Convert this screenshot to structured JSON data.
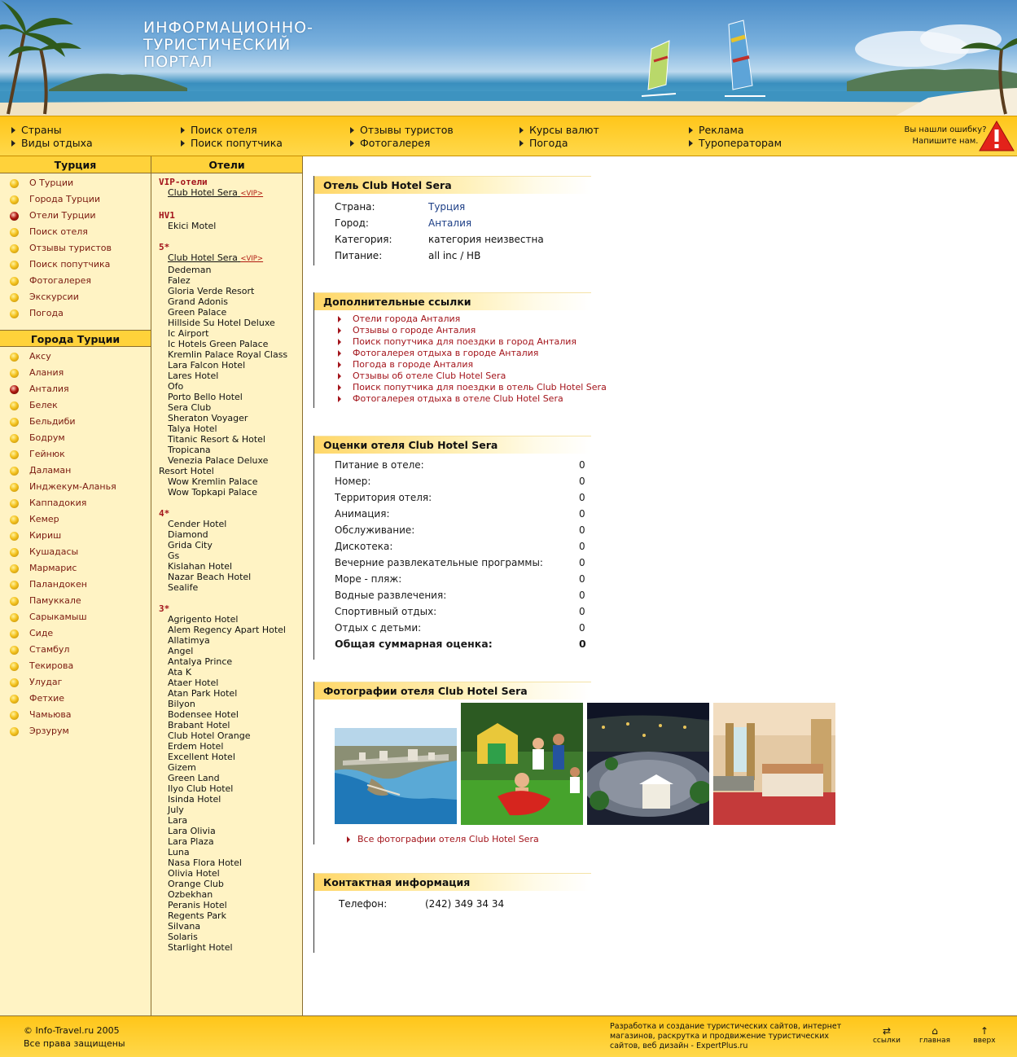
{
  "header": {
    "title_lines": [
      "ИНФОРМАЦИОННО-",
      "ТУРИСТИЧЕСКИЙ",
      "ПОРТАЛ"
    ]
  },
  "topnav": {
    "columns": [
      [
        "Страны",
        "Виды отдыха"
      ],
      [
        "Поиск отеля",
        "Поиск попутчика"
      ],
      [
        "Отзывы туристов",
        "Фотогалерея"
      ],
      [
        "Курсы валют",
        "Погода"
      ],
      [
        "Реклама",
        "Туроператорам"
      ]
    ],
    "error_line1": "Вы нашли ошибку?",
    "error_line2": "Напишите нам."
  },
  "left_menu": {
    "heading": "Турция",
    "items": [
      "О Турции",
      "Города Турции",
      "Отели Турции",
      "Поиск отеля",
      "Отзывы туристов",
      "Поиск попутчика",
      "Фотогалерея",
      "Экскурсии",
      "Погода"
    ],
    "active_index": 2
  },
  "cities_menu": {
    "heading": "Города Турции",
    "items": [
      "Аксу",
      "Алания",
      "Анталия",
      "Белек",
      "Бельдиби",
      "Бодрум",
      "Гейнюк",
      "Даламан",
      "Инджекум-Аланья",
      "Каппадокия",
      "Кемер",
      "Кириш",
      "Кушадасы",
      "Мармарис",
      "Паландокен",
      "Памуккале",
      "Сарыкамыш",
      "Сиде",
      "Стамбул",
      "Текирова",
      "Улудаг",
      "Фетхие",
      "Чамьюва",
      "Эрзурум"
    ],
    "active_index": 2
  },
  "hotels": {
    "heading": "Отели",
    "vip_mark": "<VIP>",
    "groups": [
      {
        "title": "VIP-отели",
        "items": [
          {
            "name": "Club Hotel Sera",
            "vip": true
          }
        ]
      },
      {
        "title": "HV1",
        "items": [
          {
            "name": "Ekici Motel"
          }
        ]
      },
      {
        "title": "5*",
        "items": [
          {
            "name": "Club Hotel Sera",
            "vip": true
          },
          {
            "name": "Dedeman"
          },
          {
            "name": "Falez"
          },
          {
            "name": "Gloria Verde Resort"
          },
          {
            "name": "Grand Adonis"
          },
          {
            "name": "Green Palace"
          },
          {
            "name": "Hillside Su Hotel Deluxe"
          },
          {
            "name": "Ic Airport"
          },
          {
            "name": "Ic Hotels Green Palace"
          },
          {
            "name": "Kremlin Palace Royal Class"
          },
          {
            "name": "Lara Falcon Hotel"
          },
          {
            "name": "Lares Hotel"
          },
          {
            "name": "Ofo"
          },
          {
            "name": "Porto Bello Hotel"
          },
          {
            "name": "Sera Club"
          },
          {
            "name": "Sheraton Voyager"
          },
          {
            "name": "Talya Hotel"
          },
          {
            "name": "Titanic Resort & Hotel"
          },
          {
            "name": "Tropicana"
          },
          {
            "name": "Venezia Palace Deluxe"
          }
        ],
        "sub": "Resort Hotel",
        "sub_items": [
          {
            "name": "Wow Kremlin Palace"
          },
          {
            "name": "Wow Topkapi Palace"
          }
        ]
      },
      {
        "title": "4*",
        "items": [
          {
            "name": "Cender Hotel"
          },
          {
            "name": "Diamond"
          },
          {
            "name": "Grida City"
          },
          {
            "name": "Gs"
          },
          {
            "name": "Kislahan Hotel"
          },
          {
            "name": "Nazar Beach Hotel"
          },
          {
            "name": "Sealife"
          }
        ]
      },
      {
        "title": "3*",
        "items": [
          {
            "name": "Agrigento Hotel"
          },
          {
            "name": "Alem Regency Apart Hotel"
          },
          {
            "name": "Allatimya"
          },
          {
            "name": "Angel"
          },
          {
            "name": "Antalya Prince"
          },
          {
            "name": "Ata K"
          },
          {
            "name": "Ataer Hotel"
          },
          {
            "name": "Atan Park Hotel"
          },
          {
            "name": "Bilyon"
          },
          {
            "name": "Bodensee Hotel"
          },
          {
            "name": "Brabant Hotel"
          },
          {
            "name": "Club Hotel Orange"
          },
          {
            "name": "Erdem Hotel"
          },
          {
            "name": "Excellent Hotel"
          },
          {
            "name": "Gizem"
          },
          {
            "name": "Green Land"
          },
          {
            "name": "Ilyo Club Hotel"
          },
          {
            "name": "Isinda Hotel"
          },
          {
            "name": "July"
          },
          {
            "name": "Lara"
          },
          {
            "name": "Lara Olivia"
          },
          {
            "name": "Lara Plaza"
          },
          {
            "name": "Luna"
          },
          {
            "name": "Nasa Flora Hotel"
          },
          {
            "name": "Olivia Hotel"
          },
          {
            "name": "Orange Club"
          },
          {
            "name": "Ozbekhan"
          },
          {
            "name": "Peranis Hotel"
          },
          {
            "name": "Regents Park"
          },
          {
            "name": "Silvana"
          },
          {
            "name": "Solaris"
          },
          {
            "name": "Starlight Hotel"
          }
        ]
      }
    ]
  },
  "hotel_info": {
    "heading": "Отель Club Hotel Sera",
    "rows": [
      {
        "k": "Страна:",
        "v": "Турция",
        "link": true
      },
      {
        "k": "Город:",
        "v": "Анталия",
        "link": true
      },
      {
        "k": "Категория:",
        "v": "категория неизвестна",
        "link": false
      },
      {
        "k": "Питание:",
        "v": "all inc / HB",
        "link": false
      }
    ]
  },
  "extra_links": {
    "heading": "Дополнительные ссылки",
    "items": [
      "Отели города Анталия",
      "Отзывы о городе Анталия",
      "Поиск попутчика для поездки в город Анталия",
      "Фотогалерея отдыха в городе Анталия",
      "Погода в городе Анталия",
      "Отзывы об отеле Club Hotel Sera",
      "Поиск попутчика для поездки в отель Club Hotel Sera",
      "Фотогалерея отдыха в отеле Club Hotel Sera"
    ]
  },
  "ratings": {
    "heading": "Оценки отеля Club Hotel Sera",
    "rows": [
      {
        "k": "Питание в отеле:",
        "v": "0"
      },
      {
        "k": "Номер:",
        "v": "0"
      },
      {
        "k": "Территория отеля:",
        "v": "0"
      },
      {
        "k": "Анимация:",
        "v": "0"
      },
      {
        "k": "Обслуживание:",
        "v": "0"
      },
      {
        "k": "Дискотека:",
        "v": "0"
      },
      {
        "k": "Вечерние развлекательные программы:",
        "v": "0"
      },
      {
        "k": "Море - пляж:",
        "v": "0"
      },
      {
        "k": "Водные развлечения:",
        "v": "0"
      },
      {
        "k": "Спортивный отдых:",
        "v": "0"
      },
      {
        "k": "Отдых с детьми:",
        "v": "0"
      }
    ],
    "total_label": "Общая суммарная оценка:",
    "total_value": "0"
  },
  "photos": {
    "heading": "Фотографии отеля Club Hotel Sera",
    "all_link": "Все фотографии отеля Club Hotel Sera"
  },
  "contacts": {
    "heading": "Контактная информация",
    "phone_label": "Телефон:",
    "phone_value": "(242) 349 34 34"
  },
  "footer": {
    "copyright": "© Info-Travel.ru 2005",
    "rights": "Все права защищены",
    "dev_text": "Разработка и создание туристических сайтов, интернет магазинов, раскрутка и продвижение туристических сайтов, веб дизайн - ExpertPlus.ru",
    "links_label": "ссылки",
    "home_label": "главная",
    "up_label": "вверх"
  },
  "colors": {
    "accent_yellow": "#ffc61a",
    "link_red": "#a3141b",
    "column_bg": "#fff3c4"
  }
}
